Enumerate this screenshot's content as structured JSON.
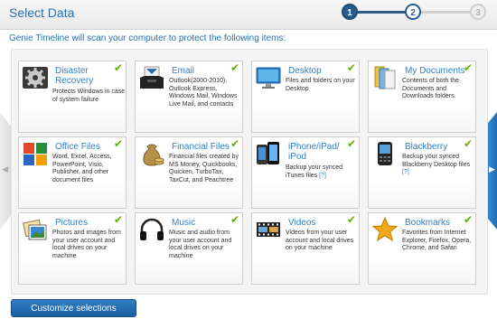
{
  "header": {
    "title": "Select Data",
    "steps": [
      "1",
      "2",
      "3"
    ]
  },
  "subtitle": "Genie Timeline will scan your computer to protect the following items:",
  "nav": {
    "left_arrow": "◀",
    "right_arrow": "▶"
  },
  "accent_color": "#2e7fc6",
  "check_color": "#5fb000",
  "cards": [
    {
      "name": "Disaster Recovery",
      "desc": "Protects Windows in case of system failure",
      "icon": "gear-icon"
    },
    {
      "name": "Email",
      "desc": "Outlook(2000-2010), Outlook Express, Windows Mail, Windows Live Mail, and contacts",
      "icon": "email-tray-icon"
    },
    {
      "name": "Desktop",
      "desc": "Files and folders on your Desktop",
      "icon": "desktop-monitor-icon"
    },
    {
      "name": "My Documents",
      "desc": "Contents of both the Documents and Downloads folders.",
      "icon": "documents-folder-icon"
    },
    {
      "name": "Office Files",
      "desc": "Word, Excel, Access, PowerPoint, Visio, Publisher, and other document files",
      "icon": "office-files-icon"
    },
    {
      "name": "Financial Files",
      "desc": "Financial files created by MS Money, Quickbooks, Quicken, TurboTax, TaxCut, and Peachtree",
      "icon": "money-bag-icon"
    },
    {
      "name": "iPhone/iPad/ iPod",
      "desc": "Backup your synced iTunes files",
      "link": "[?]",
      "icon": "iphone-icon"
    },
    {
      "name": "Blackberry",
      "desc": "Backup your synced Blackberry Desktop files",
      "link": "[?]",
      "icon": "blackberry-icon"
    },
    {
      "name": "Pictures",
      "desc": "Photos and images from your user account and local drives on your machine",
      "icon": "pictures-icon"
    },
    {
      "name": "Music",
      "desc": "Music and audio from your user account and local drives on your machine",
      "icon": "headphones-icon"
    },
    {
      "name": "Videos",
      "desc": "Videos from your user account and local drives on your machine",
      "icon": "film-strip-icon"
    },
    {
      "name": "Bookmarks",
      "desc": "Favorites from Internet Explorer, Firefox, Opera, Chrome, and Safari",
      "icon": "star-icon"
    }
  ],
  "check_glyph": "✔",
  "customize_button": "Customize selections"
}
